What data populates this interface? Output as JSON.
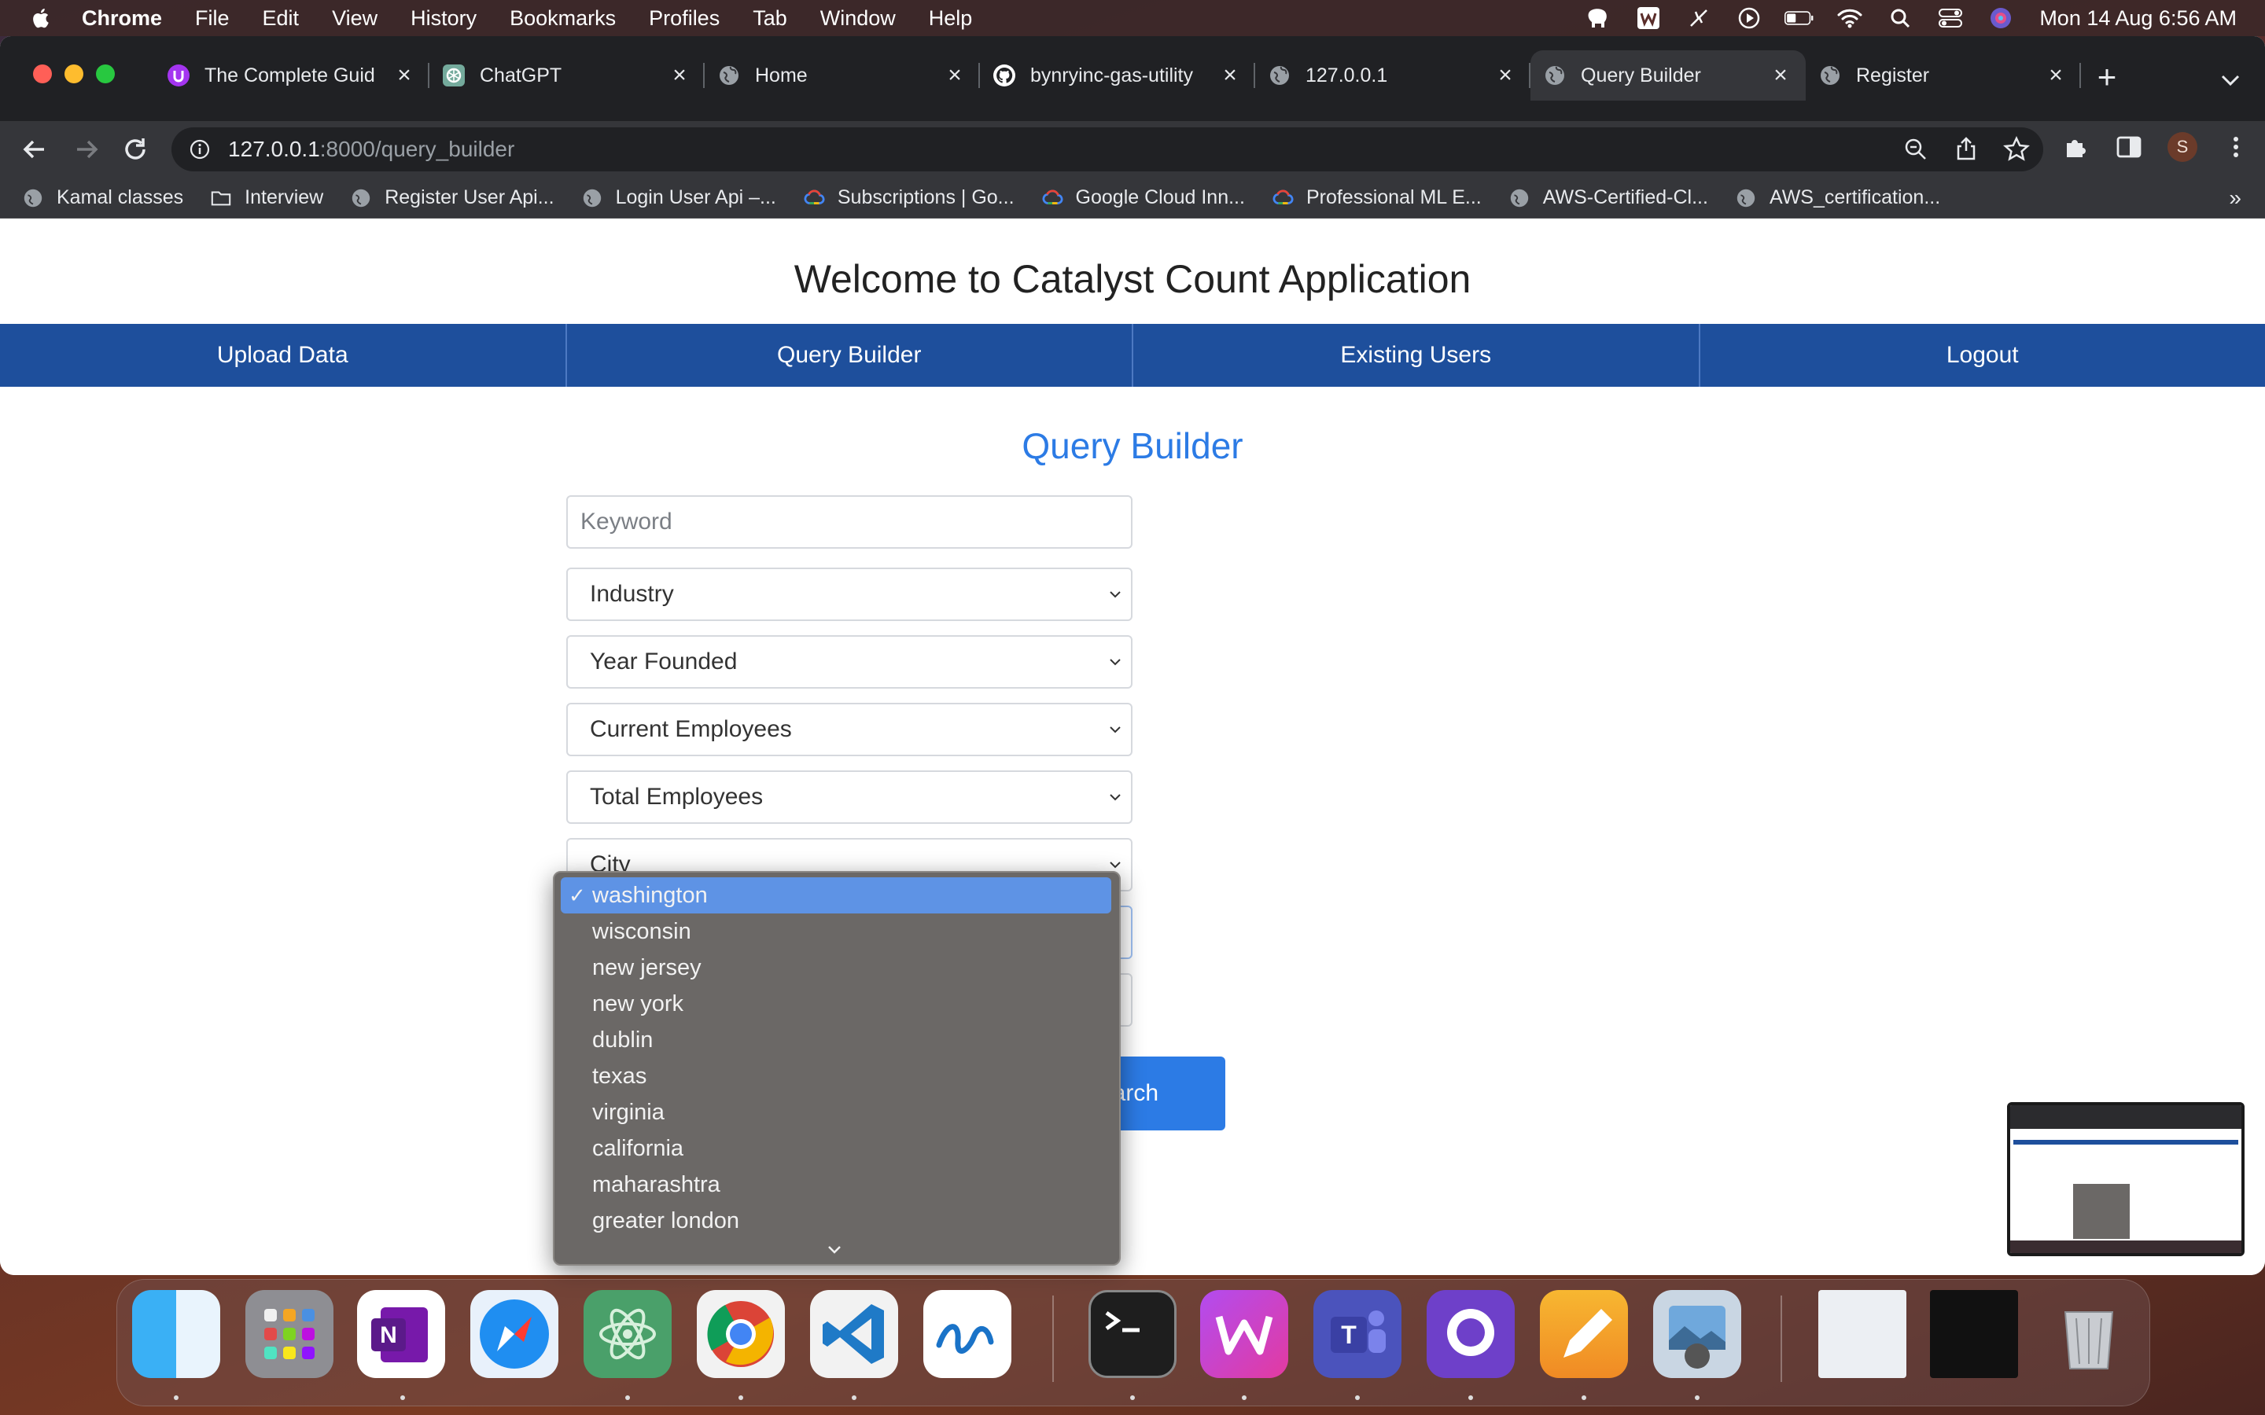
{
  "menubar": {
    "app": "Chrome",
    "items": [
      "File",
      "Edit",
      "View",
      "History",
      "Bookmarks",
      "Profiles",
      "Tab",
      "Window",
      "Help"
    ],
    "clock": "Mon 14 Aug  6:56 AM"
  },
  "tabs": [
    {
      "title": "The Complete Guid",
      "icon": "purple-u-icon"
    },
    {
      "title": "ChatGPT",
      "icon": "chatgpt-icon"
    },
    {
      "title": "Home",
      "icon": "globe-icon"
    },
    {
      "title": "bynryinc-gas-utility",
      "icon": "github-icon"
    },
    {
      "title": "127.0.0.1",
      "icon": "globe-icon"
    },
    {
      "title": "Query Builder",
      "icon": "globe-icon",
      "active": true
    },
    {
      "title": "Register",
      "icon": "globe-icon"
    }
  ],
  "address": {
    "host": "127.0.0.1",
    "path": ":8000/query_builder"
  },
  "profile_initial": "S",
  "bookmarks": [
    {
      "label": "Kamal classes",
      "icon": "globe-icon"
    },
    {
      "label": "Interview",
      "icon": "folder-icon"
    },
    {
      "label": "Register User Api...",
      "icon": "globe-icon"
    },
    {
      "label": "Login User Api –...",
      "icon": "globe-icon"
    },
    {
      "label": "Subscriptions | Go...",
      "icon": "google-cloud-icon"
    },
    {
      "label": "Google Cloud Inn...",
      "icon": "google-cloud-icon"
    },
    {
      "label": "Professional ML E...",
      "icon": "google-cloud-icon"
    },
    {
      "label": "AWS-Certified-Cl...",
      "icon": "globe-icon"
    },
    {
      "label": "AWS_certification...",
      "icon": "globe-icon"
    }
  ],
  "page": {
    "welcome": "Welcome to Catalyst Count Application",
    "nav": [
      "Upload Data",
      "Query Builder",
      "Existing Users",
      "Logout"
    ],
    "title": "Query Builder",
    "keyword_placeholder": "Keyword",
    "selects": [
      "Industry",
      "Year Founded",
      "Current Employees",
      "Total Employees",
      "City"
    ],
    "search_label": "earch"
  },
  "dropdown": {
    "selected": "washington",
    "options": [
      "washington",
      "wisconsin",
      "new jersey",
      "new york",
      "dublin",
      "texas",
      "virginia",
      "california",
      "maharashtra",
      "greater london"
    ]
  },
  "colors": {
    "nav_blue": "#1e4f9c",
    "accent_blue": "#2c7be5",
    "dropdown_bg": "#6b6866",
    "selected_bg": "#5e93e5"
  },
  "dock_apps": [
    "finder",
    "launchpad",
    "onenote",
    "safari",
    "atom",
    "chrome",
    "vscode",
    "freeform",
    "terminal",
    "wps-office",
    "teams",
    "github-desktop",
    "pages",
    "preview",
    "document-stack",
    "screenshot-stack",
    "trash"
  ]
}
